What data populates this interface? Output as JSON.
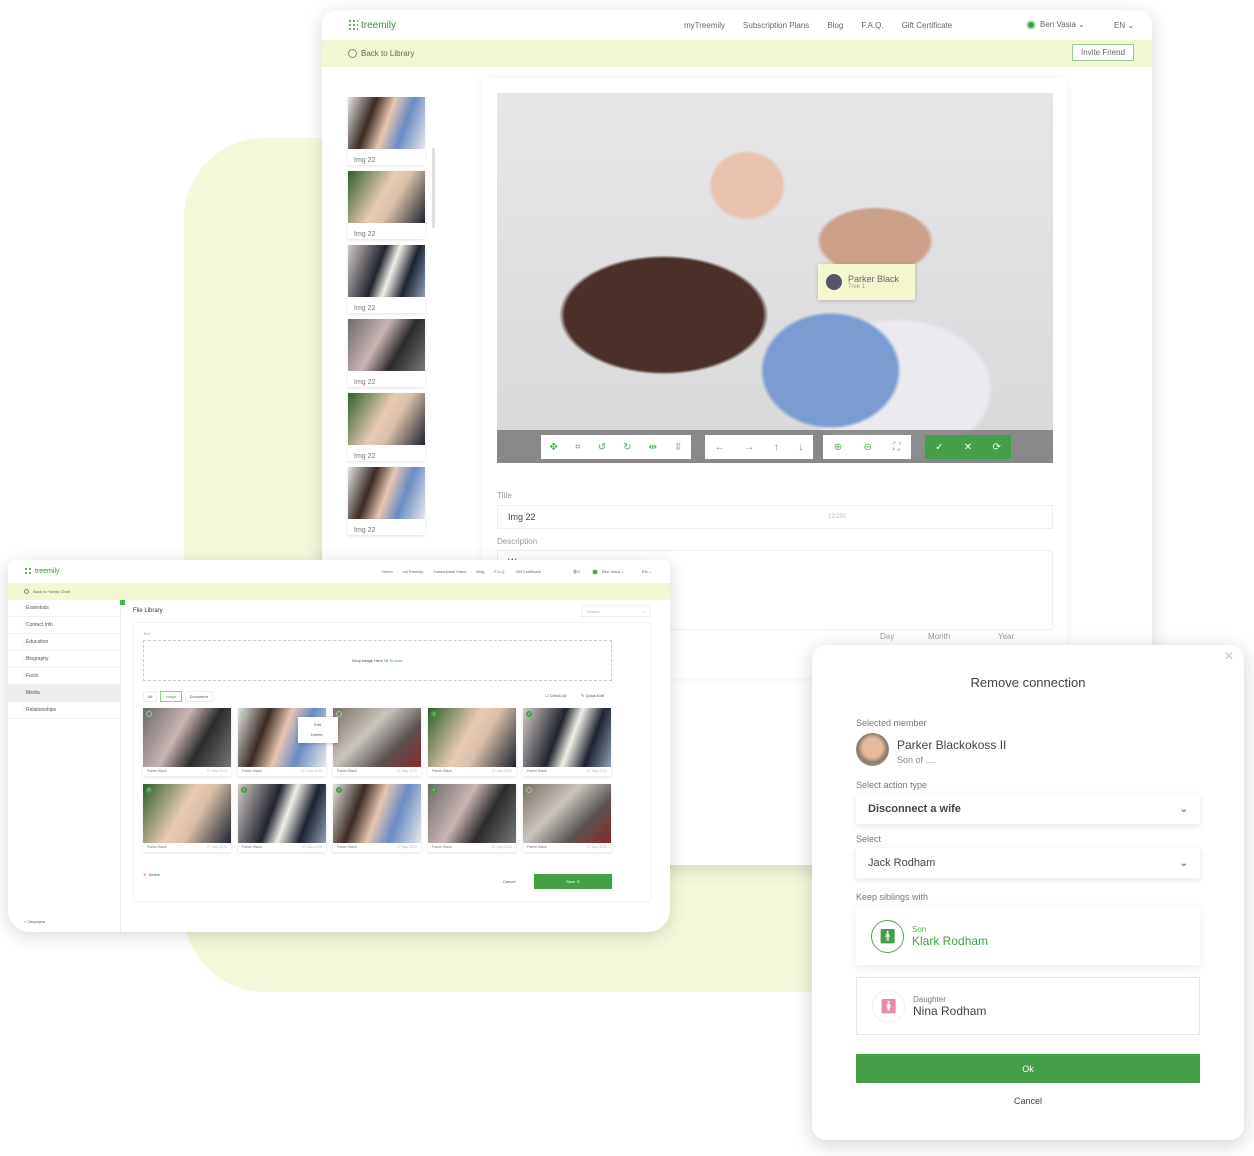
{
  "colors": {
    "brand": "#43a047",
    "highlight": "#f3f6d2",
    "daughter": "#e88aa8"
  },
  "editor": {
    "logo": "treemily",
    "nav": [
      "myTreemily",
      "Subscription Plans",
      "Blog",
      "F.A.Q.",
      "Gift Certificate"
    ],
    "user": "Ben Vasia",
    "lang": "EN",
    "back": "Back to Library",
    "invite": "Invite Friend",
    "thumbs": [
      "Img 22",
      "Img 22",
      "Img 22",
      "Img 22",
      "Img 22",
      "Img 22"
    ],
    "tag": {
      "name": "Parker Black",
      "sub": "Tree 1"
    },
    "toolbar_icons": [
      "move-icon",
      "crop-icon",
      "rotate-left-icon",
      "rotate-right-icon",
      "flip-horizontal-icon",
      "flip-vertical-icon",
      "arrow-left-icon",
      "arrow-right-icon",
      "arrow-up-icon",
      "arrow-down-icon",
      "zoom-in-icon",
      "zoom-out-icon",
      "fit-icon",
      "check-icon",
      "close-icon",
      "reset-icon"
    ],
    "title_label": "Title",
    "title_value": "Img 22",
    "title_counter": "12/250",
    "desc_label": "Description",
    "desc_value": "We",
    "date": [
      "Day",
      "Month",
      "Year"
    ]
  },
  "library": {
    "logo": "treemily",
    "nav": [
      "Demo",
      "myTreemily",
      "Subscription Plans",
      "Blog",
      "F.A.Q.",
      "Gift Certificate"
    ],
    "cart": "2",
    "user": "Ben Vasia",
    "lang": "EN",
    "back": "Back to Family Chart",
    "sidebar": [
      "Essentials",
      "Contact Info",
      "Education",
      "Biography",
      "Facts",
      "Media",
      "Relationships"
    ],
    "collapse": "Свернуть",
    "title": "File Library",
    "search_placeholder": "Search",
    "text_label": "Text",
    "drop": "Drop Image Here Or ",
    "browse": "Browse",
    "filters": [
      "All",
      "Image",
      "Document"
    ],
    "check_all": "Check All",
    "quick_edit": "Quick Edit",
    "menu": [
      "Edit",
      "Delete"
    ],
    "items": [
      {
        "name": "Parker Black",
        "date": "07 May 2020",
        "checked": false
      },
      {
        "name": "Parker Black",
        "date": "07 May 2020",
        "checked": false
      },
      {
        "name": "Parker Black",
        "date": "07 May 2020",
        "checked": false
      },
      {
        "name": "Parker Black",
        "date": "07 May 2020",
        "checked": true
      },
      {
        "name": "Parker Black",
        "date": "07 May 2020",
        "checked": true
      },
      {
        "name": "Parker Black",
        "date": "07 May 2020",
        "checked": true
      },
      {
        "name": "Parker Black",
        "date": "07 May 2020",
        "checked": true
      },
      {
        "name": "Parker Black",
        "date": "07 May 2020",
        "checked": true
      },
      {
        "name": "Parker Black",
        "date": "07 May 2020",
        "checked": true
      },
      {
        "name": "Parker Black",
        "date": "07 May 2020",
        "checked": false
      }
    ],
    "delete": "Delete",
    "cancel": "Cancel",
    "save": "Save"
  },
  "modal": {
    "title": "Remove connection",
    "selected_label": "Selected member",
    "member_name": "Parker Blackokoss II",
    "member_sub": "Son of ....",
    "action_label": "Select action type",
    "action_value": "Disconnect a wife",
    "select_label": "Select",
    "select_value": "Jack Rodham",
    "siblings_label": "Keep siblings with",
    "siblings": [
      {
        "role": "Son",
        "name": "Klark Rodham",
        "selected": true
      },
      {
        "role": "Daughter",
        "name": "Nina Rodham",
        "selected": false
      }
    ],
    "ok": "Ok",
    "cancel": "Cancel"
  }
}
